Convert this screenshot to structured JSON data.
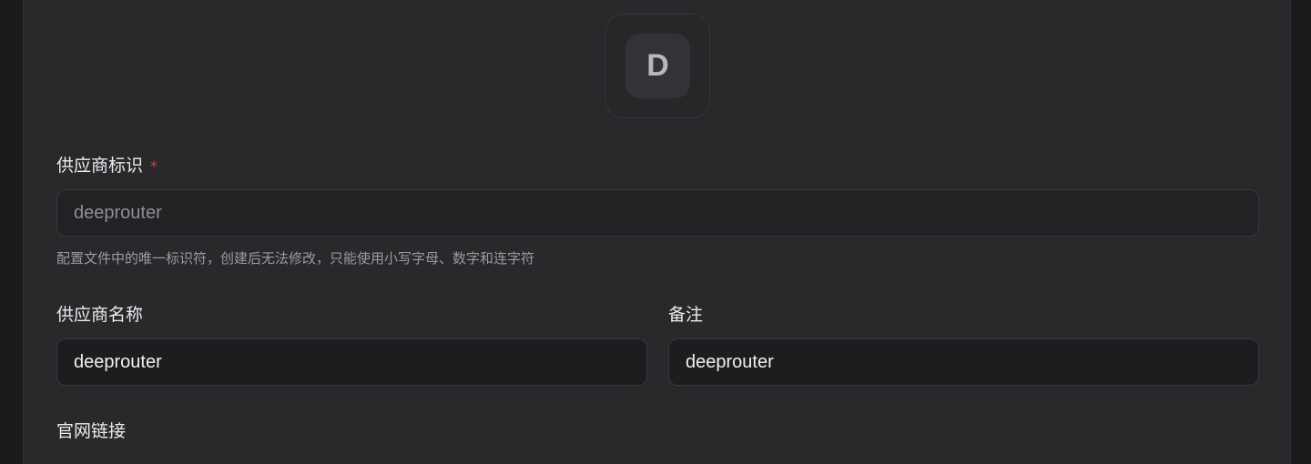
{
  "avatar": {
    "letter": "D"
  },
  "provider_id": {
    "label": "供应商标识",
    "required_mark": "*",
    "value": "deeprouter",
    "hint": "配置文件中的唯一标识符，创建后无法修改，只能使用小写字母、数字和连字符"
  },
  "provider_name": {
    "label": "供应商名称",
    "value": "deeprouter"
  },
  "notes": {
    "label": "备注",
    "value": "deeprouter"
  },
  "website": {
    "label": "官网链接"
  },
  "colors": {
    "background": "#1b1b1d",
    "panel": "#29292c",
    "input_bg": "#1d1d20",
    "required": "#d04646"
  }
}
